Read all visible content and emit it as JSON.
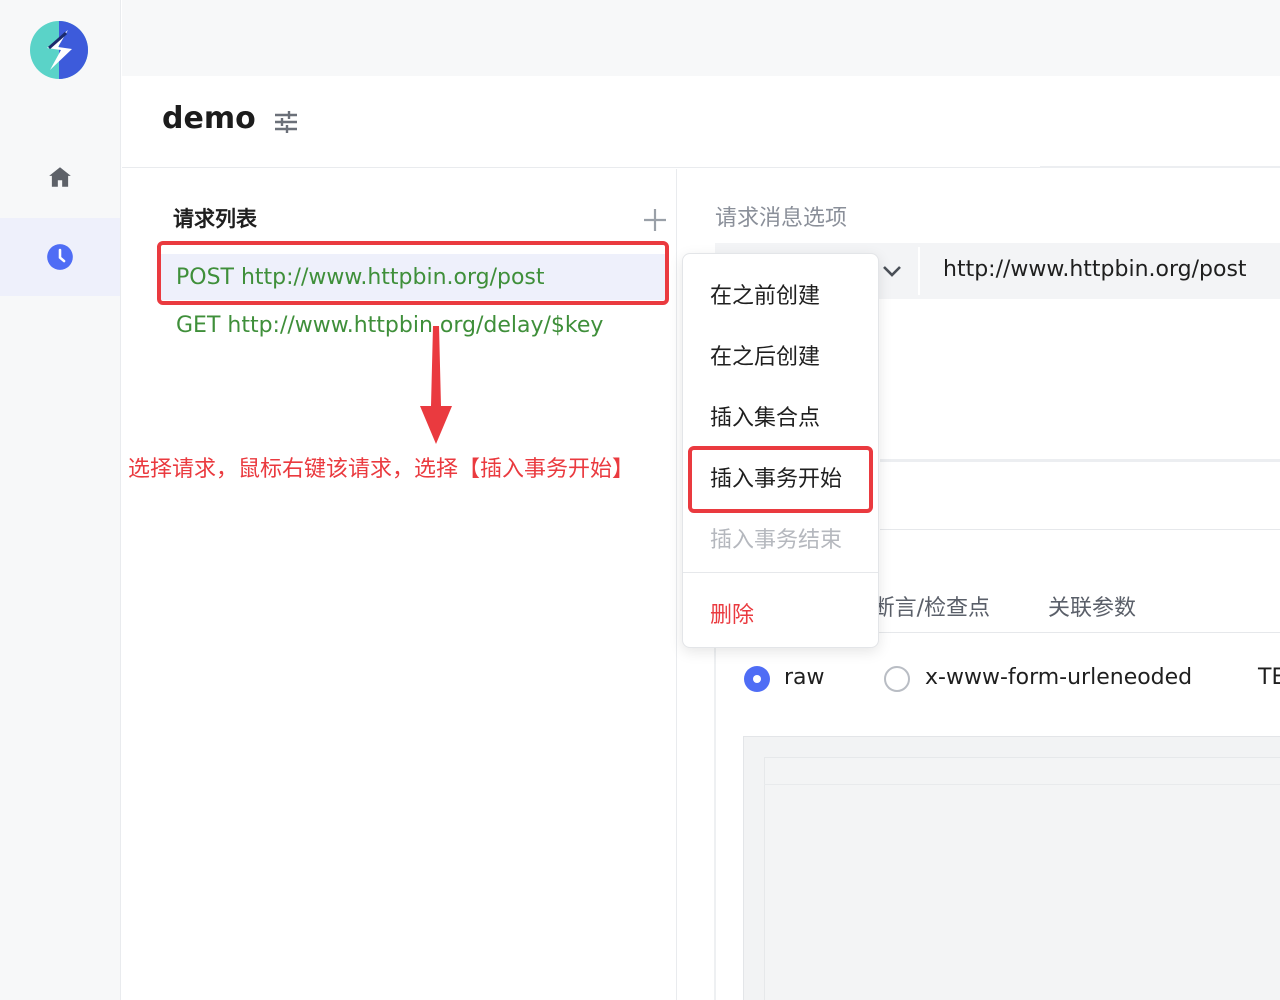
{
  "app": {
    "project_title": "demo"
  },
  "sidebar": {
    "items": [
      {
        "icon": "home-icon"
      },
      {
        "icon": "clock-icon",
        "active": true
      }
    ]
  },
  "request_list": {
    "title": "请求列表",
    "add_icon": "plus-icon",
    "items": [
      {
        "label": "POST http://www.httpbin.org/post",
        "selected": true
      },
      {
        "label": "GET http://www.httpbin.org/delay/$key"
      }
    ]
  },
  "annotation": {
    "text": "选择请求，鼠标右键该请求，选择【插入事务开始】"
  },
  "editor": {
    "section_label": "请求消息选项",
    "url": "http://www.httpbin.org/post",
    "tabs": [
      "断言/检查点",
      "关联参数"
    ],
    "body_type": {
      "options": [
        "raw",
        "x-www-form-urleneoded",
        "TE"
      ],
      "selected": "raw"
    }
  },
  "context_menu": {
    "items": [
      {
        "label": "在之前创建"
      },
      {
        "label": "在之后创建"
      },
      {
        "label": "插入集合点"
      },
      {
        "label": "插入事务开始",
        "highlighted": true
      },
      {
        "label": "插入事务结束",
        "disabled": true
      },
      {
        "label": "删除",
        "danger": true
      }
    ]
  },
  "colors": {
    "accent": "#4f6df5",
    "request_text": "#3f8f3a",
    "annotation_red": "#ea3a3f",
    "selected_bg": "#eef0fb"
  }
}
